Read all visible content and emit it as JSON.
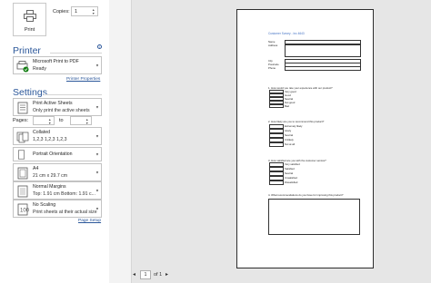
{
  "print": {
    "button_label": "Print"
  },
  "copies": {
    "label": "Copies:",
    "value": "1"
  },
  "printer": {
    "title": "Printer",
    "name": "Microsoft Print to PDF",
    "status": "Ready",
    "properties_link": "Printer Properties"
  },
  "settings": {
    "title": "Settings",
    "print_what": {
      "line1": "Print Active Sheets",
      "line2": "Only print the active sheets"
    },
    "pages": {
      "label": "Pages:",
      "to": "to",
      "from_value": "",
      "to_value": ""
    },
    "collate": {
      "line1": "Collated",
      "line2": "1,2,3    1,2,3    1,2,3"
    },
    "orientation": {
      "line1": "Portrait Orientation"
    },
    "paper": {
      "line1": "A4",
      "line2": "21 cm x 29.7 cm"
    },
    "margins": {
      "line1": "Normal Margins",
      "line2": "Top: 1.91 cm Bottom: 1.91 c..."
    },
    "scaling": {
      "line1": "No Scaling",
      "line2": "Print sheets at their actual size"
    },
    "page_setup_link": "Page Setup"
  },
  "navigation": {
    "current_page": "1",
    "of_label": "of 1"
  },
  "preview": {
    "title": "Customer Survey - Inc 4643",
    "fields": [
      "Name",
      "Address",
      "",
      "City",
      "Postcode",
      "Phone"
    ],
    "q1": {
      "question": "1. How would you rate your experience with our product?",
      "options": [
        "Very good",
        "Good",
        "Neutral",
        "Not good",
        "Bad"
      ]
    },
    "q2": {
      "question": "2. How likely are you to recommend this product?",
      "options": [
        "Extremely likely",
        "Likely",
        "Neutral",
        "Unlikely",
        "Not at all"
      ]
    },
    "q3": {
      "question": "3. How satisfied are you with the customer service?",
      "options": [
        "Very satisfied",
        "Satisfied",
        "Neutral",
        "Unsatisfied",
        "Dissatisfied"
      ]
    },
    "q4": {
      "question": "4. What recommendations do you have for improving this product?"
    }
  },
  "colors": {
    "accent": "#2b579a",
    "preview_bg": "#e6e6e6",
    "title_blue": "#4472c4"
  }
}
